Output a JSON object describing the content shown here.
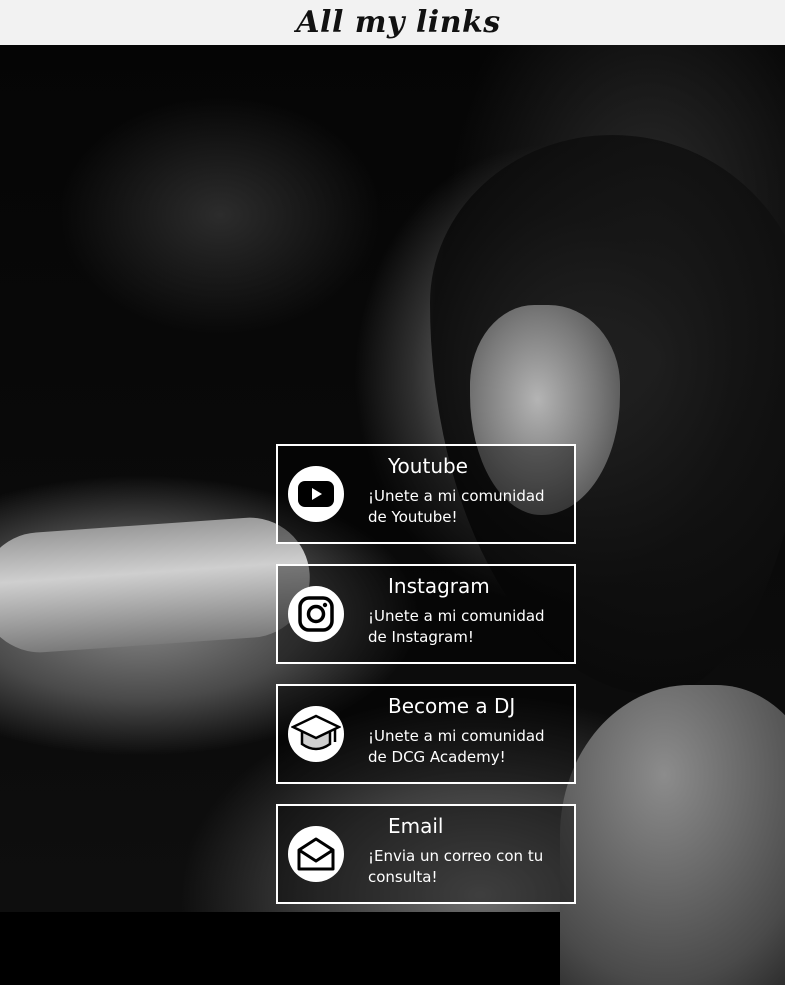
{
  "header": {
    "title": "All my links"
  },
  "links": [
    {
      "icon": "youtube-icon",
      "title": "Youtube",
      "description": "¡Unete a mi comunidad de Youtube!"
    },
    {
      "icon": "instagram-icon",
      "title": "Instagram",
      "description": "¡Unete a mi comunidad de Instagram!"
    },
    {
      "icon": "graduation-cap-icon",
      "title": "Become a DJ",
      "description": "¡Unete a mi comunidad de DCG Academy!"
    },
    {
      "icon": "envelope-icon",
      "title": "Email",
      "description": "¡Envia un correo con tu consulta!"
    }
  ]
}
